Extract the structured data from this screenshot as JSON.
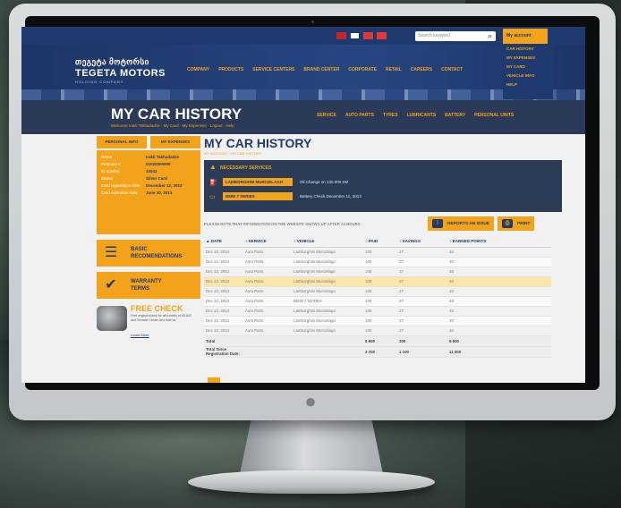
{
  "topbar": {
    "flags": [
      "#c3272b",
      "#1f3a6e",
      "#c3272b",
      "#c3272b"
    ],
    "search_placeholder": "Search keyword",
    "my_account_label": "My account"
  },
  "logo": {
    "geo": "თეგეტა მოტორსი",
    "main": "TEGETA MOTORS",
    "sub": "HOLDING COMPANY"
  },
  "main_nav": [
    "COMPANY",
    "PRODUCTS",
    "SERVICE CENTERS",
    "BRAND CENTER",
    "CORPORATE",
    "RETAIL",
    "CAREERS",
    "CONTACT"
  ],
  "account_menu": [
    "CAR HISTORY",
    "MY EXPENSES",
    "MY CARD",
    "VEHICLE INFO",
    "HELP"
  ],
  "title_band": {
    "title": "MY CAR HISTORY",
    "breadcrumb": "Welcome Irakli Tskhadadze  ·  My Card  ·  My Expenses  ·  Logout  ·  Help"
  },
  "sub_nav": [
    "SERVICE",
    "AUTO PARTS",
    "TYRES",
    "LUBRICANTS",
    "BATTERY",
    "PERSONAL UNITS"
  ],
  "sidebar": {
    "tabs": [
      "PERSONAL INFO",
      "MY EXPENSES"
    ],
    "info": [
      {
        "k": "Name",
        "v": "Irakli Tskhadadze"
      },
      {
        "k": "Personal #",
        "v": "01020000000"
      },
      {
        "k": "ID number",
        "v": "10043"
      },
      {
        "k": "Status",
        "v": "Silver Card"
      },
      {
        "k": "Card registration date",
        "v": "December 12, 2013"
      },
      {
        "k": "Card expiration date",
        "v": "June 10, 2013"
      }
    ],
    "cards": [
      {
        "icon": "☰",
        "label1": "BASIC",
        "label2": "RECOMENDATIONS"
      },
      {
        "icon": "✔",
        "label1": "WARRANTY",
        "label2": "TERMS"
      }
    ],
    "freecheck": {
      "title": "FREE CHECK",
      "text": "Free engine check for all models of 45 A/G and Tematic Center and limit us",
      "link": "Learn More"
    }
  },
  "content": {
    "title": "MY CAR HISTORY",
    "crumb": "MY ACCOUNT  ›  MY CAR HISTORY",
    "services_title": "NECESSARY SERVICES",
    "services": [
      {
        "tag": "LAMBORGHINI MURCIELAGO",
        "desc": "Oil Change on 130 000 KM"
      },
      {
        "tag": "BMW 7 SERIES",
        "desc": "Battery Check December 11, 2013"
      }
    ],
    "note": "PLEASE NOTE THAT INFORMATION ON THE WEBSITE SHOWS UP AFTER 24 HOURS",
    "btn_reports": "REPORTS AN ISSUE",
    "btn_print": "PRINT"
  },
  "table": {
    "headers": [
      "▲ DATE",
      "↕ SERVICE",
      "↕ VEHICLE",
      "↕ PAID",
      "↕ SAVINGS",
      "↕ EARNED POINTS"
    ],
    "rows": [
      [
        "Dec 12, 2013",
        "Auto Parts",
        "Lamborghini Murcielago",
        "100",
        "27",
        "40"
      ],
      [
        "Dec 12, 2013",
        "Auto Parts",
        "Lamborghini Murcielago",
        "100",
        "27",
        "40"
      ],
      [
        "Dec 12, 2013",
        "Auto Parts",
        "Lamborghini Murcielago",
        "100",
        "27",
        "40"
      ],
      [
        "Dec 12, 2013",
        "Auto Parts",
        "Lamborghini Murcielago",
        "100",
        "27",
        "40"
      ],
      [
        "Dec 12, 2013",
        "Auto Parts",
        "Lamborghini Murcielago",
        "100",
        "27",
        "40"
      ],
      [
        "Dec 12, 2013",
        "Auto Parts",
        "BMW 7 SERIES",
        "100",
        "27",
        "40"
      ],
      [
        "Dec 12, 2013",
        "Auto Parts",
        "Lamborghini Murcielago",
        "100",
        "27",
        "40"
      ],
      [
        "Dec 12, 2013",
        "Auto Parts",
        "Lamborghini Murcielago",
        "100",
        "27",
        "40"
      ],
      [
        "Dec 12, 2013",
        "Auto Parts",
        "Lamborghini Murcielago",
        "100",
        "27",
        "40"
      ]
    ],
    "total_row": [
      "Total",
      "",
      "",
      "8 900",
      "300",
      "9 900"
    ],
    "since_row": [
      "Total Since Registration Date:",
      "",
      "",
      "3 700",
      "1 100",
      "11 000"
    ]
  },
  "colors": {
    "accent": "#f3a21b",
    "brand": "#1f3a6e"
  }
}
